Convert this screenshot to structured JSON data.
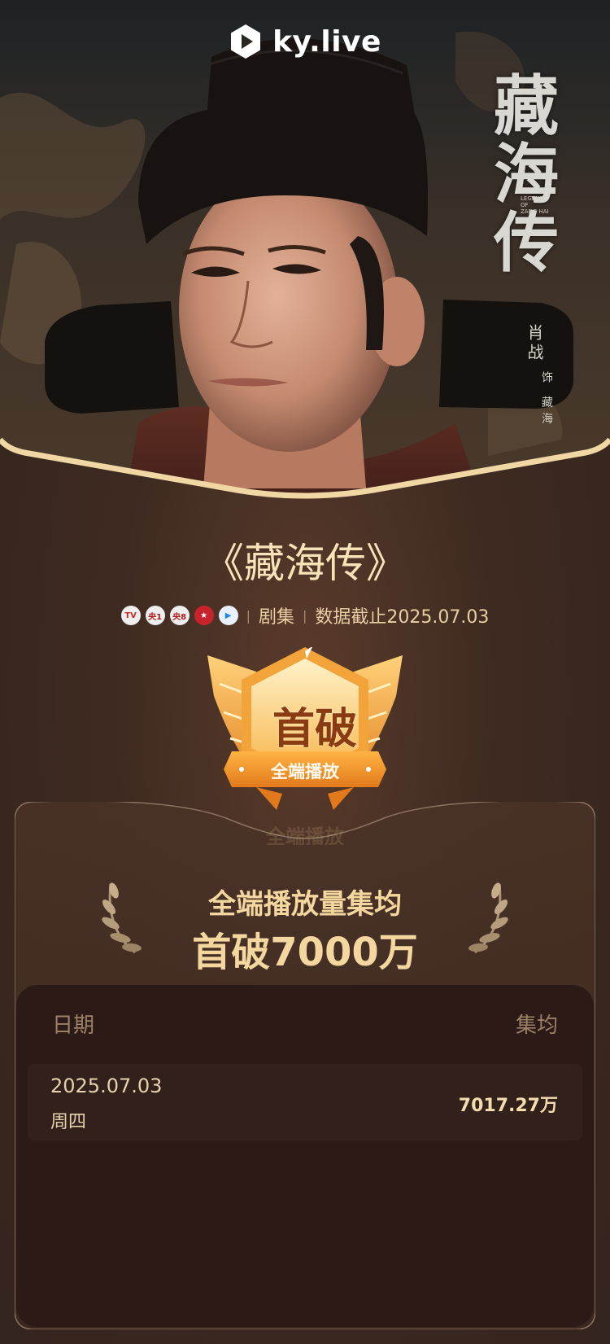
{
  "brand": {
    "name": "ky.live",
    "icon": "play-logo-icon"
  },
  "poster": {
    "title_chars": [
      "藏",
      "海",
      "传"
    ],
    "subtitle_lines": [
      "LEGEND",
      "OF",
      "ZANG HAI"
    ],
    "actor": "肖战",
    "role": "饰 藏海"
  },
  "show": {
    "title": "《藏海传》",
    "platforms": [
      {
        "icon": "tv-icon",
        "text": "TV"
      },
      {
        "icon": "cctv1-icon",
        "text": "央1"
      },
      {
        "icon": "cctv8-icon",
        "text": "央8"
      },
      {
        "icon": "dragon-tv-icon",
        "text": "★"
      },
      {
        "icon": "youku-icon",
        "text": "▶"
      }
    ],
    "category": "剧集",
    "data_as_of": "数据截止2025.07.03"
  },
  "badge": {
    "top_text": "首破",
    "bottom_text": "全端播放",
    "reflection_text": "全端播放"
  },
  "summary": {
    "line1": "全端播放量集均",
    "line2": "首破7000万"
  },
  "table": {
    "headers": {
      "date": "日期",
      "value": "集均"
    },
    "rows": [
      {
        "date": "2025.07.03",
        "weekday": "周四",
        "value": "7017.27万"
      }
    ]
  },
  "colors": {
    "background": "#3b2820",
    "gold_text": "#f3d79e",
    "badge_orange": "#f6a530",
    "frame_cream": "#f1d7a3"
  }
}
